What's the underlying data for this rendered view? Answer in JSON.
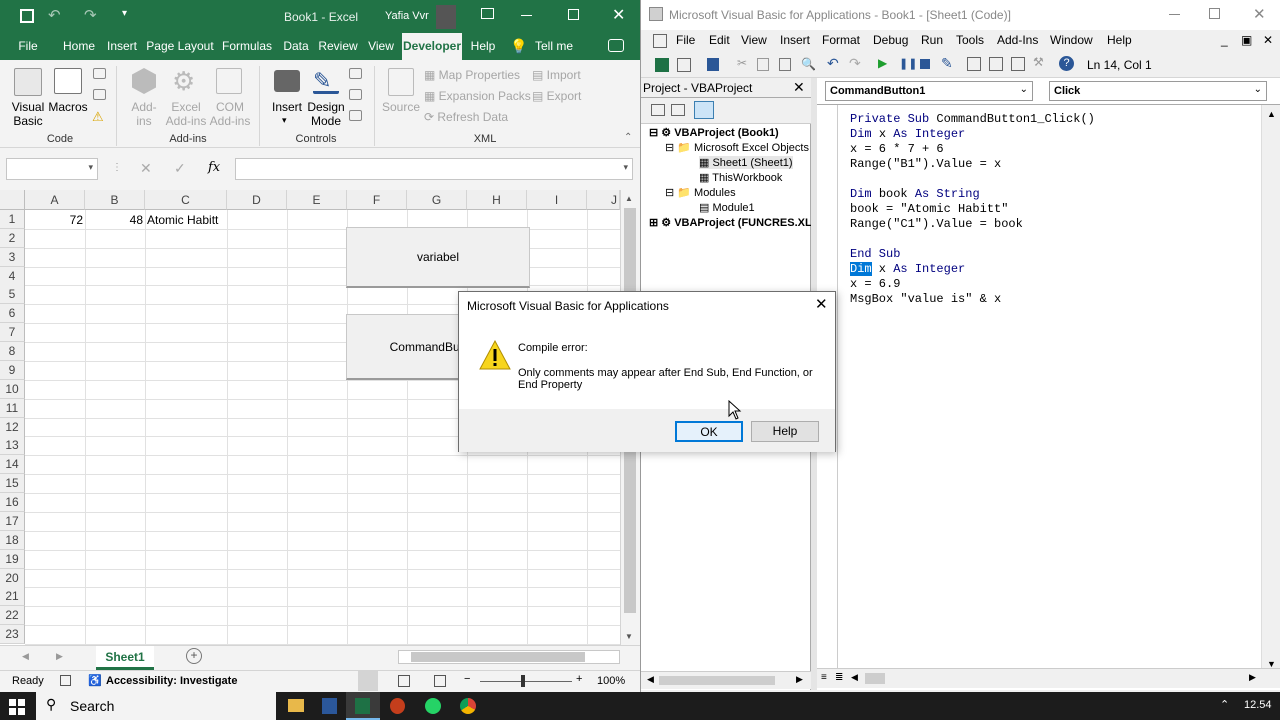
{
  "excel": {
    "title": "Book1  -  Excel",
    "user": "Yafia Vvr",
    "tabs": [
      "File",
      "Home",
      "Insert",
      "Page Layout",
      "Formulas",
      "Data",
      "Review",
      "View",
      "Developer",
      "Help",
      "Tell me"
    ],
    "ribbon": {
      "code": {
        "visual_basic": "Visual\nBasic",
        "macros": "Macros",
        "group": "Code"
      },
      "addins": {
        "addins": "Add-\nins",
        "excel_addins": "Excel\nAdd-ins",
        "com_addins": "COM\nAdd-ins",
        "group": "Add-ins"
      },
      "controls": {
        "insert": "Insert",
        "design_mode": "Design\nMode",
        "group": "Controls"
      },
      "xml": {
        "source": "Source",
        "map_properties": "Map Properties",
        "expansion_packs": "Expansion Packs",
        "refresh_data": "Refresh Data",
        "import": "Import",
        "export": "Export",
        "group": "XML"
      }
    },
    "fx_label": "fx",
    "columns": [
      "A",
      "B",
      "C",
      "D",
      "E",
      "F",
      "G",
      "H",
      "I",
      "J"
    ],
    "rows": [
      "1",
      "2",
      "3",
      "4",
      "5",
      "6",
      "7",
      "8",
      "9",
      "10",
      "11",
      "12",
      "13",
      "14",
      "15",
      "16",
      "17",
      "18",
      "19",
      "20",
      "21",
      "22",
      "23"
    ],
    "cells": {
      "A1": "72",
      "B1": "48",
      "C1": "Atomic Habitt"
    },
    "shape_buttons": {
      "variabel": "variabel",
      "command": "CommandButton1"
    },
    "sheet_tab": "Sheet1",
    "status": {
      "ready": "Ready",
      "accessibility": "Accessibility: Investigate",
      "zoom": "100%"
    }
  },
  "vba": {
    "title": "Microsoft Visual Basic for Applications - Book1 - [Sheet1 (Code)]",
    "menu": [
      "File",
      "Edit",
      "View",
      "Insert",
      "Format",
      "Debug",
      "Run",
      "Tools",
      "Add-Ins",
      "Window",
      "Help"
    ],
    "position": "Ln 14, Col 1",
    "project_title": "Project - VBAProject",
    "tree": [
      "VBAProject (Book1)",
      "Microsoft Excel Objects",
      "Sheet1 (Sheet1)",
      "ThisWorkbook",
      "Modules",
      "Module1",
      "VBAProject (FUNCRES.XL"
    ],
    "object_combo": "CommandButton1",
    "proc_combo": "Click",
    "code_lines": [
      {
        "kw": "Private Sub ",
        "rest": "CommandButton1_Click()"
      },
      {
        "kw": "Dim ",
        "rest": "x ",
        "kw2": "As Integer"
      },
      {
        "kw": "",
        "rest": "x = 6 * 7 + 6"
      },
      {
        "kw": "",
        "rest": "Range(\"B1\").Value = x"
      },
      {
        "kw": "",
        "rest": ""
      },
      {
        "kw": "Dim ",
        "rest": "book ",
        "kw2": "As String"
      },
      {
        "kw": "",
        "rest": "book = \"Atomic Habitt\""
      },
      {
        "kw": "",
        "rest": "Range(\"C1\").Value = book"
      },
      {
        "kw": "",
        "rest": ""
      },
      {
        "kw": "End Sub",
        "rest": ""
      },
      {
        "kw": "Dim",
        "rest": " x ",
        "kw2": "As Integer",
        "selected": true
      },
      {
        "kw": "",
        "rest": "x = 6.9"
      },
      {
        "kw": "",
        "rest": "MsgBox \"value is\" & x"
      }
    ]
  },
  "dialog": {
    "title": "Microsoft Visual Basic for Applications",
    "heading": "Compile error:",
    "message": "Only comments may appear after End Sub, End Function, or End Property",
    "ok": "OK",
    "help": "Help"
  },
  "taskbar": {
    "search": "Search",
    "time": "12.54"
  }
}
